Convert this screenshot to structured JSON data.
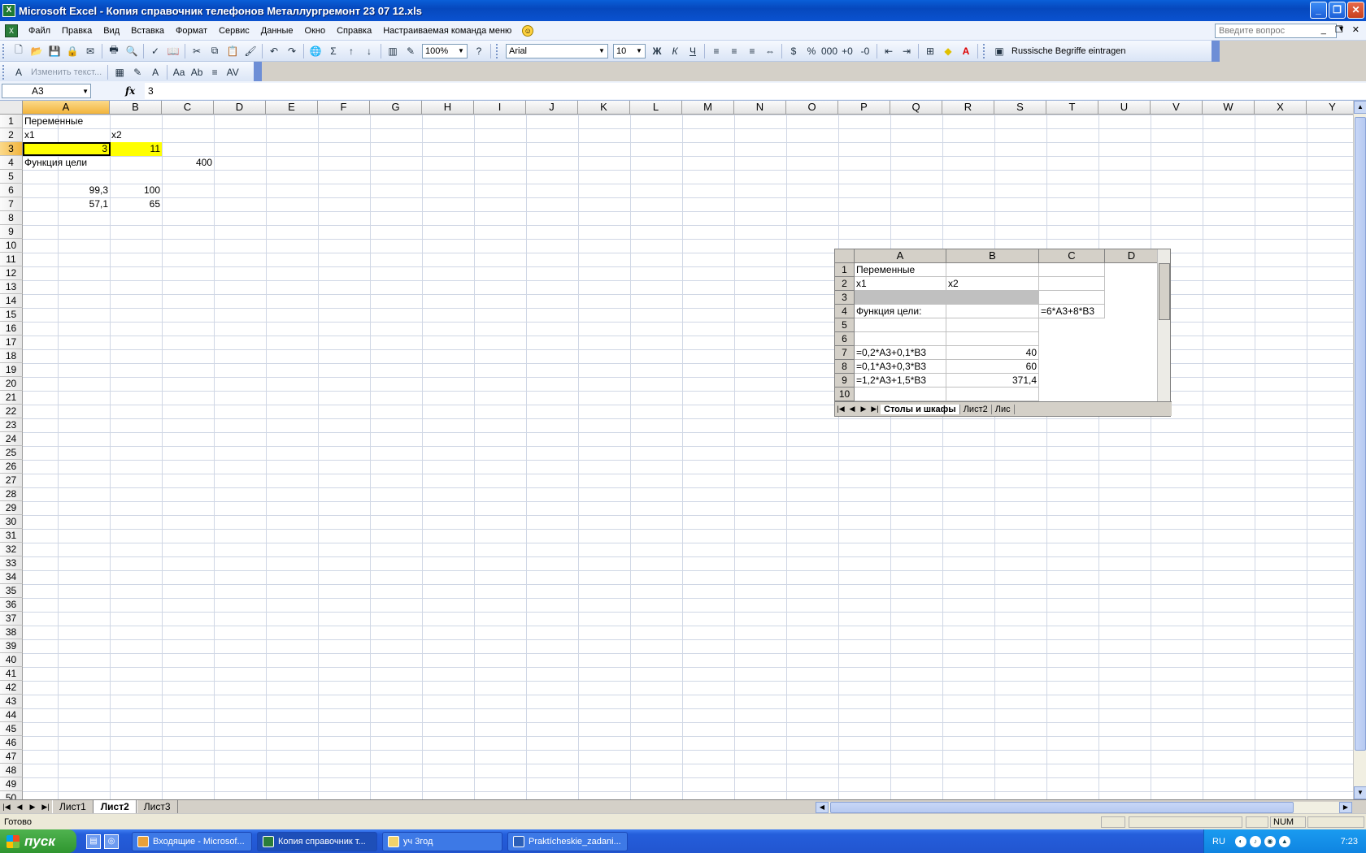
{
  "window": {
    "title": "Microsoft Excel - Копия справочник телефонов Металлургремонт 23 07 12.xls",
    "app_icon": "excel-icon"
  },
  "menu": {
    "items": [
      "Файл",
      "Правка",
      "Вид",
      "Вставка",
      "Формат",
      "Сервис",
      "Данные",
      "Окно",
      "Справка",
      "Настраиваемая команда меню"
    ],
    "help_placeholder": "Введите вопрос"
  },
  "toolbar": {
    "zoom": "100%",
    "font": "Arial",
    "font_size": "10",
    "bold": "Ж",
    "italic": "К",
    "underline": "Ч",
    "russian_button": "Russische Begriffe eintragen",
    "wordart_edit": "Изменить текст..."
  },
  "formula_bar": {
    "name_box": "A3",
    "fx": "fx",
    "value": "3"
  },
  "columns": [
    "A",
    "B",
    "C",
    "D",
    "E",
    "F",
    "G",
    "H",
    "I",
    "J",
    "K",
    "L",
    "M",
    "N",
    "O",
    "P",
    "Q",
    "R",
    "S",
    "T",
    "U",
    "V",
    "W",
    "X",
    "Y"
  ],
  "rows_count": 50,
  "cells": {
    "A1": "Переменные",
    "A2": "x1",
    "B2": "x2",
    "A3": "3",
    "B3": "11",
    "A4": "Функция цели",
    "C4": "400",
    "A6": "99,3",
    "B6": "100",
    "A7": "57,1",
    "B7": "65"
  },
  "embedded_image": {
    "columns": [
      "A",
      "B",
      "C",
      "D"
    ],
    "rows": [
      "1",
      "2",
      "3",
      "4",
      "5",
      "6",
      "7",
      "8",
      "9",
      "10"
    ],
    "cells": {
      "A1": "Переменные",
      "A2": "x1",
      "B2": "x2",
      "A4": "Функция цели:",
      "C4": "=6*A3+8*B3",
      "A7": "=0,2*A3+0,1*B3",
      "B7": "40",
      "A8": "=0,1*A3+0,3*B3",
      "B8": "60",
      "A9": "=1,2*A3+1,5*B3",
      "B9": "371,4"
    },
    "tabs": [
      "Столы и шкафы",
      "Лист2",
      "Лис"
    ]
  },
  "sheet_tabs": [
    "Лист1",
    "Лист2",
    "Лист3"
  ],
  "active_sheet": "Лист2",
  "status": {
    "ready": "Готово",
    "num": "NUM"
  },
  "taskbar": {
    "start": "пуск",
    "tasks": [
      "Входящие - Microsof...",
      "Копия справочник т...",
      "уч 3год",
      "Praktícheskie_zadani..."
    ],
    "lang": "RU",
    "clock": "7:23"
  },
  "colors": {
    "selection_yellow": "#ffff00",
    "title_blue": "#0648bd",
    "header_selected": "#f2b43c"
  }
}
